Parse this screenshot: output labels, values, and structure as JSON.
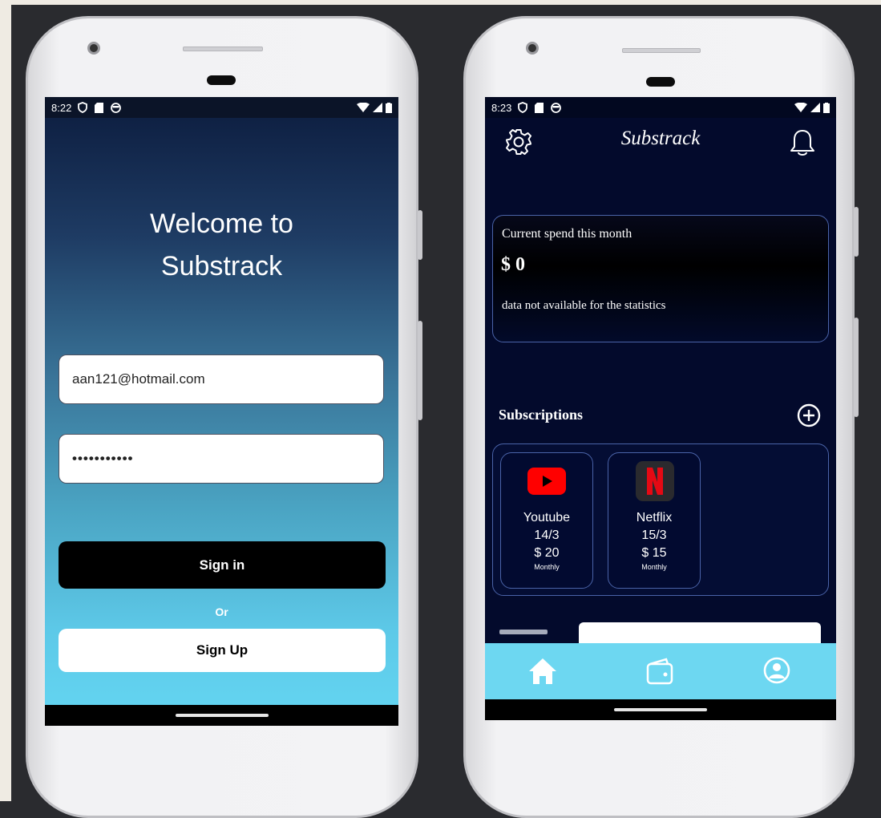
{
  "signin_screen": {
    "status": {
      "time": "8:22"
    },
    "welcome_line1": "Welcome to",
    "welcome_line2": "Substrack",
    "email_value": "aan121@hotmail.com",
    "password_value": "•••••••••••",
    "signin_label": "Sign in",
    "or_label": "Or",
    "signup_label": "Sign Up"
  },
  "home_screen": {
    "status": {
      "time": "8:23"
    },
    "app_title": "Substrack",
    "spend_title": "Current spend this month",
    "spend_amount": "$ 0",
    "spend_note": "data not available for the statistics",
    "subscriptions_header": "Subscriptions",
    "subscriptions": [
      {
        "name": "Youtube",
        "date": "14/3",
        "price": "$ 20",
        "frequency": "Monthly",
        "icon": "youtube-icon"
      },
      {
        "name": "Netflix",
        "date": "15/3",
        "price": "$ 15",
        "frequency": "Monthly",
        "icon": "netflix-icon"
      }
    ],
    "bottom_nav": [
      "home-icon",
      "wallet-icon",
      "profile-icon"
    ]
  },
  "colors": {
    "accent": "#6dd7f1",
    "dark_bg": "#030a2c",
    "card_border": "#4a63a8"
  }
}
